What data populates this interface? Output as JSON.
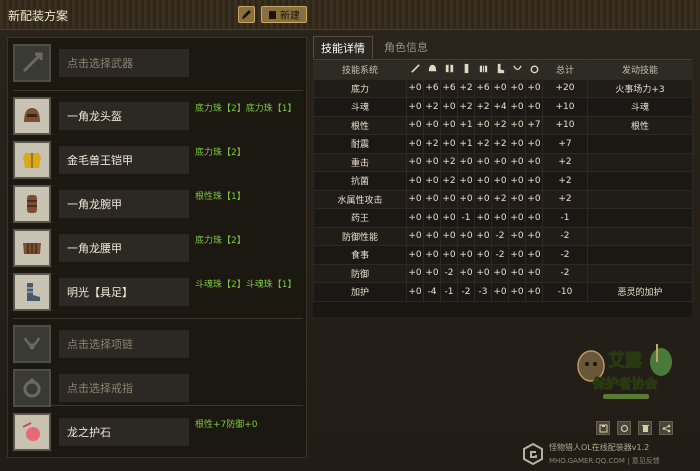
{
  "header": {
    "title": "新配装方案",
    "new_label": "新建"
  },
  "slots": [
    {
      "name": "点击选择武器",
      "placeholder": true,
      "icon": "weapon-icon",
      "deco": ""
    },
    {
      "name": "一角龙头盔",
      "placeholder": false,
      "icon": "helmet-icon",
      "deco": "底力珠【2】底力珠【1】"
    },
    {
      "name": "金毛兽王铠甲",
      "placeholder": false,
      "icon": "chest-armor-icon",
      "deco": "底力珠【2】"
    },
    {
      "name": "一角龙腕甲",
      "placeholder": false,
      "icon": "gauntlet-icon",
      "deco": "根性珠【1】"
    },
    {
      "name": "一角龙腰甲",
      "placeholder": false,
      "icon": "waist-armor-icon",
      "deco": "底力珠【2】"
    },
    {
      "name": "明光【具足】",
      "placeholder": false,
      "icon": "greaves-icon",
      "deco": "斗魂珠【2】斗魂珠【1】"
    },
    {
      "name": "点击选择项链",
      "placeholder": true,
      "icon": "necklace-icon",
      "deco": ""
    },
    {
      "name": "点击选择戒指",
      "placeholder": true,
      "icon": "ring-icon",
      "deco": ""
    },
    {
      "name": "龙之护石",
      "placeholder": false,
      "icon": "talisman-icon",
      "deco": "根性+7防御+0"
    }
  ],
  "tabs": {
    "skill": "技能详情",
    "char": "角色信息"
  },
  "table": {
    "col_skill": "技能系统",
    "col_total": "总计",
    "col_active": "发动技能",
    "slot_icons": [
      "weapon-icon",
      "helmet-icon",
      "chest-armor-icon",
      "gauntlet-icon",
      "waist-armor-icon",
      "greaves-icon",
      "necklace-icon",
      "ring-icon"
    ],
    "rows": [
      {
        "skill": "底力",
        "values": [
          "+0",
          "+6",
          "+6",
          "+2",
          "+6",
          "+0",
          "+0",
          "+0"
        ],
        "total": "+20",
        "active": "火事场力+3"
      },
      {
        "skill": "斗魂",
        "values": [
          "+0",
          "+2",
          "+0",
          "+2",
          "+2",
          "+4",
          "+0",
          "+0"
        ],
        "total": "+10",
        "active": "斗魂"
      },
      {
        "skill": "根性",
        "values": [
          "+0",
          "+0",
          "+0",
          "+1",
          "+0",
          "+2",
          "+0",
          "+7"
        ],
        "total": "+10",
        "active": "根性"
      },
      {
        "skill": "耐震",
        "values": [
          "+0",
          "+2",
          "+0",
          "+1",
          "+2",
          "+2",
          "+0",
          "+0"
        ],
        "total": "+7",
        "active": ""
      },
      {
        "skill": "重击",
        "values": [
          "+0",
          "+0",
          "+2",
          "+0",
          "+0",
          "+0",
          "+0",
          "+0"
        ],
        "total": "+2",
        "active": ""
      },
      {
        "skill": "抗菌",
        "values": [
          "+0",
          "+0",
          "+2",
          "+0",
          "+0",
          "+0",
          "+0",
          "+0"
        ],
        "total": "+2",
        "active": ""
      },
      {
        "skill": "水属性攻击",
        "values": [
          "+0",
          "+0",
          "+0",
          "+0",
          "+0",
          "+2",
          "+0",
          "+0"
        ],
        "total": "+2",
        "active": ""
      },
      {
        "skill": "药王",
        "values": [
          "+0",
          "+0",
          "+0",
          "-1",
          "+0",
          "+0",
          "+0",
          "+0"
        ],
        "total": "-1",
        "active": ""
      },
      {
        "skill": "防御性能",
        "values": [
          "+0",
          "+0",
          "+0",
          "+0",
          "+0",
          "-2",
          "+0",
          "+0"
        ],
        "total": "-2",
        "active": ""
      },
      {
        "skill": "食事",
        "values": [
          "+0",
          "+0",
          "+0",
          "+0",
          "+0",
          "-2",
          "+0",
          "+0"
        ],
        "total": "-2",
        "active": ""
      },
      {
        "skill": "防御",
        "values": [
          "+0",
          "+0",
          "-2",
          "+0",
          "+0",
          "+0",
          "+0",
          "+0"
        ],
        "total": "-2",
        "active": ""
      },
      {
        "skill": "加护",
        "values": [
          "+0",
          "-4",
          "-1",
          "-2",
          "-3",
          "+0",
          "+0",
          "+0"
        ],
        "total": "-10",
        "active": "恶灵的加护"
      }
    ]
  },
  "logo": {
    "line1": "艾露",
    "line2": "保护者协会"
  },
  "footer": {
    "line1": "怪物猎人OL在线配装器v1.2",
    "line2": "MHO.GAMER.QQ.COM | 意见反馈"
  }
}
